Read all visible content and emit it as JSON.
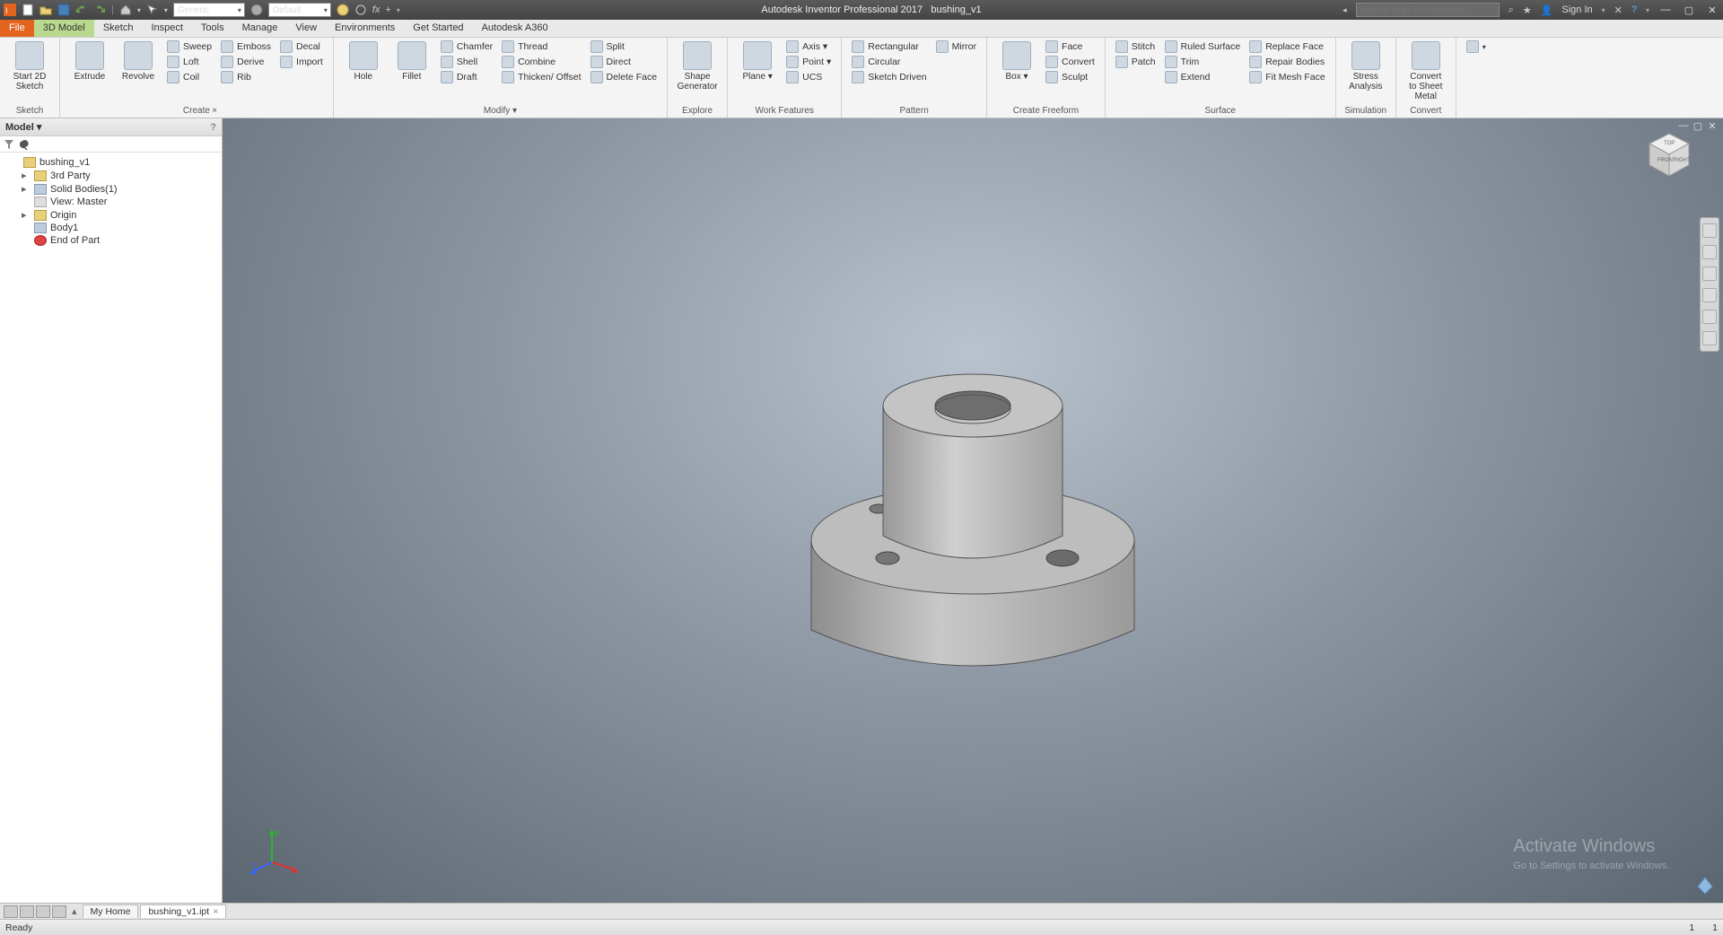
{
  "titlebar": {
    "app_title": "Autodesk Inventor Professional 2017",
    "doc_title": "bushing_v1",
    "material_dd": "Generic",
    "appearance_dd": "Default",
    "search_placeholder": "Search Help & Commands...",
    "sign_in": "Sign In"
  },
  "menu_tabs": [
    "File",
    "3D Model",
    "Sketch",
    "Inspect",
    "Tools",
    "Manage",
    "View",
    "Environments",
    "Get Started",
    "Autodesk A360"
  ],
  "active_tab": "3D Model",
  "ribbon": {
    "groups": [
      {
        "label": "Sketch",
        "big": [
          {
            "label": "Start\n2D Sketch"
          }
        ],
        "cols": []
      },
      {
        "label": "Create",
        "big": [
          {
            "label": "Extrude"
          },
          {
            "label": "Revolve"
          }
        ],
        "cols": [
          [
            {
              "l": "Sweep"
            },
            {
              "l": "Loft"
            },
            {
              "l": "Coil"
            }
          ],
          [
            {
              "l": "Emboss"
            },
            {
              "l": "Derive"
            },
            {
              "l": "Rib"
            }
          ],
          [
            {
              "l": "Decal"
            },
            {
              "l": "Import"
            }
          ]
        ]
      },
      {
        "label": "Modify ▾",
        "big": [
          {
            "label": "Hole"
          },
          {
            "label": "Fillet"
          }
        ],
        "cols": [
          [
            {
              "l": "Chamfer"
            },
            {
              "l": "Shell"
            },
            {
              "l": "Draft"
            }
          ],
          [
            {
              "l": "Thread"
            },
            {
              "l": "Combine"
            },
            {
              "l": "Thicken/ Offset"
            }
          ],
          [
            {
              "l": "Split"
            },
            {
              "l": "Direct"
            },
            {
              "l": "Delete Face"
            }
          ]
        ]
      },
      {
        "label": "Explore",
        "big": [
          {
            "label": "Shape\nGenerator"
          }
        ],
        "cols": []
      },
      {
        "label": "Work Features",
        "big": [
          {
            "label": "Plane\n▾"
          }
        ],
        "cols": [
          [
            {
              "l": "Axis ▾"
            },
            {
              "l": "Point ▾"
            },
            {
              "l": "UCS"
            }
          ]
        ]
      },
      {
        "label": "Pattern",
        "big": [],
        "cols": [
          [
            {
              "l": "Rectangular"
            },
            {
              "l": "Circular"
            },
            {
              "l": "Sketch Driven"
            }
          ],
          [
            {
              "l": "Mirror"
            }
          ]
        ]
      },
      {
        "label": "Create Freeform",
        "big": [
          {
            "label": "Box\n▾"
          }
        ],
        "cols": [
          [
            {
              "l": "Face"
            },
            {
              "l": "Convert"
            },
            {
              "l": "Sculpt"
            }
          ]
        ]
      },
      {
        "label": "Surface",
        "big": [],
        "cols": [
          [
            {
              "l": "Stitch"
            },
            {
              "l": "Patch"
            }
          ],
          [
            {
              "l": "Ruled Surface"
            },
            {
              "l": "Trim"
            },
            {
              "l": "Extend"
            }
          ],
          [
            {
              "l": "Replace Face"
            },
            {
              "l": "Repair Bodies"
            },
            {
              "l": "Fit Mesh Face"
            }
          ]
        ]
      },
      {
        "label": "Simulation",
        "big": [
          {
            "label": "Stress\nAnalysis"
          }
        ],
        "cols": []
      },
      {
        "label": "Convert",
        "big": [
          {
            "label": "Convert to\nSheet Metal"
          }
        ],
        "cols": []
      }
    ]
  },
  "browser": {
    "title": "Model ▾",
    "tree": [
      {
        "level": 1,
        "label": "bushing_v1",
        "icon": "part-icon"
      },
      {
        "level": 2,
        "label": "3rd Party",
        "twist": "▸",
        "icon": "folder-icon"
      },
      {
        "level": 2,
        "label": "Solid Bodies(1)",
        "twist": "▸",
        "icon": "body-icon"
      },
      {
        "level": 2,
        "label": "View: Master",
        "twist": "",
        "icon": "view-icon"
      },
      {
        "level": 2,
        "label": "Origin",
        "twist": "▸",
        "icon": "folder-icon"
      },
      {
        "level": 2,
        "label": "Body1",
        "twist": "",
        "icon": "body-icon"
      },
      {
        "level": 2,
        "label": "End of Part",
        "twist": "",
        "icon": "eop-icon"
      }
    ]
  },
  "doctabs": {
    "tabs": [
      {
        "label": "My Home",
        "closable": false
      },
      {
        "label": "bushing_v1.ipt",
        "closable": true,
        "active": true
      }
    ]
  },
  "statusbar": {
    "left": "Ready",
    "right1": "1",
    "right2": "1"
  },
  "watermark": {
    "line1": "Activate Windows",
    "line2": "Go to Settings to activate Windows."
  },
  "triad": {
    "x": "x",
    "y": "y",
    "z": "z"
  }
}
